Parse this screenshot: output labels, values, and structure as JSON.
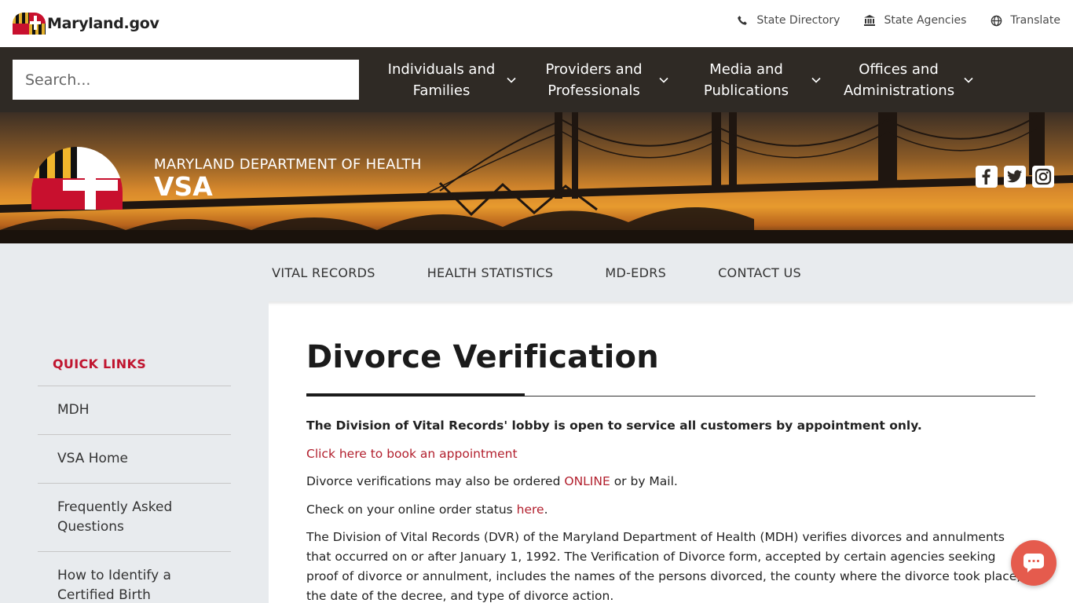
{
  "topbar": {
    "logo_text": "Maryland.gov",
    "links": [
      {
        "label": "State Directory",
        "icon": "phone-icon"
      },
      {
        "label": "State Agencies",
        "icon": "building-icon"
      },
      {
        "label": "Translate",
        "icon": "globe-icon"
      }
    ]
  },
  "navbar": {
    "search_placeholder": "Search...",
    "items": [
      {
        "line1": "Individuals and",
        "line2": "Families"
      },
      {
        "line1": "Providers and",
        "line2": "Professionals"
      },
      {
        "line1": "Media and",
        "line2": "Publications"
      },
      {
        "line1": "Offices and",
        "line2": "Administrations"
      }
    ]
  },
  "hero": {
    "department": "MARYLAND DEPARTMENT OF HEALTH",
    "unit": "VSA",
    "social": [
      "facebook-icon",
      "twitter-icon",
      "instagram-icon"
    ]
  },
  "subnav": {
    "items": [
      "VITAL RECORDS",
      "HEALTH STATISTICS",
      "MD-EDRS",
      "CONTACT US"
    ]
  },
  "sidebar": {
    "title": "QUICK LINKS",
    "items": [
      "MDH",
      "VSA Home",
      "Frequently Asked Questions",
      "How to Identify a Certified Birth"
    ]
  },
  "main": {
    "title": "Divorce Verification",
    "notice": "The Division of Vital Records' lobby is open to service all customers by appointment only.",
    "appointment_link": "Click here to book an appointment",
    "order_text_before": "Divorce verifications may also be ordered ",
    "order_link": "ONLINE",
    "order_text_after": " or by Mail.",
    "status_text_before": "Check on your online order status ",
    "status_link": "here",
    "status_text_after": ".",
    "description": "The Division of Vital Records (DVR) of the Maryland Department of Health (MDH) verifies divorces and annulments that occurred on or after January 1, 1992. The Verification of Divorce form, accepted by certain agencies seeking proof of divorce or annulment, includes the names of the persons divorced, the county where the divorce took place, the date of the decree, and type of divorce action."
  },
  "colors": {
    "accent_red": "#b21f2d",
    "nav_dark": "#2f2a25",
    "subnav_bg": "#e8ebee",
    "chat_button": "#e55b4d"
  }
}
